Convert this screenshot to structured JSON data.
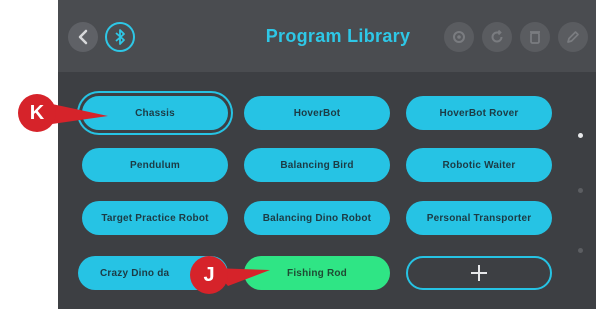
{
  "header": {
    "title": "Program Library",
    "back_icon": "chevron-left-icon",
    "bluetooth_icon": "bluetooth-icon",
    "right_icons": [
      "settings-icon",
      "refresh-icon",
      "delete-icon",
      "edit-icon"
    ]
  },
  "programs": [
    {
      "label": "Chassis"
    },
    {
      "label": "HoverBot"
    },
    {
      "label": "HoverBot Rover"
    },
    {
      "label": "Pendulum"
    },
    {
      "label": "Balancing Bird"
    },
    {
      "label": "Robotic Waiter"
    },
    {
      "label": "Target Practice Robot"
    },
    {
      "label": "Balancing Dino Robot"
    },
    {
      "label": "Personal Transporter"
    },
    {
      "label": "Crazy Dino da"
    },
    {
      "label": "Fishing Rod"
    }
  ],
  "add_button": {
    "icon": "plus-icon"
  },
  "pagination": {
    "pages": 3,
    "current": 1
  },
  "callouts": {
    "k": "K",
    "j": "J"
  },
  "colors": {
    "accent": "#26c3e4",
    "selected_green": "#2fe585",
    "background": "#3d3f43",
    "header": "#4a4c50",
    "callout": "#d6232a"
  }
}
